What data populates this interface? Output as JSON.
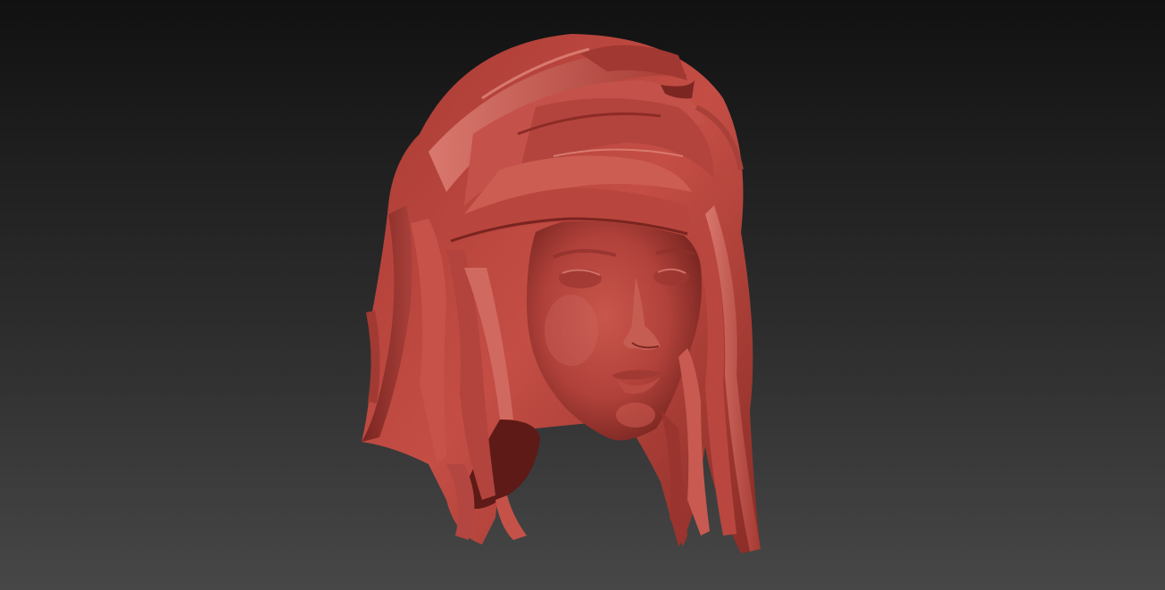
{
  "viewport": {
    "background_top": "#111111",
    "background_bottom": "#474747"
  },
  "model": {
    "name_icon": "sculpted-head-with-hair",
    "material_color": "#b9443a",
    "shadow_color": "#6e1f1a",
    "highlight_color": "#d4706a"
  }
}
